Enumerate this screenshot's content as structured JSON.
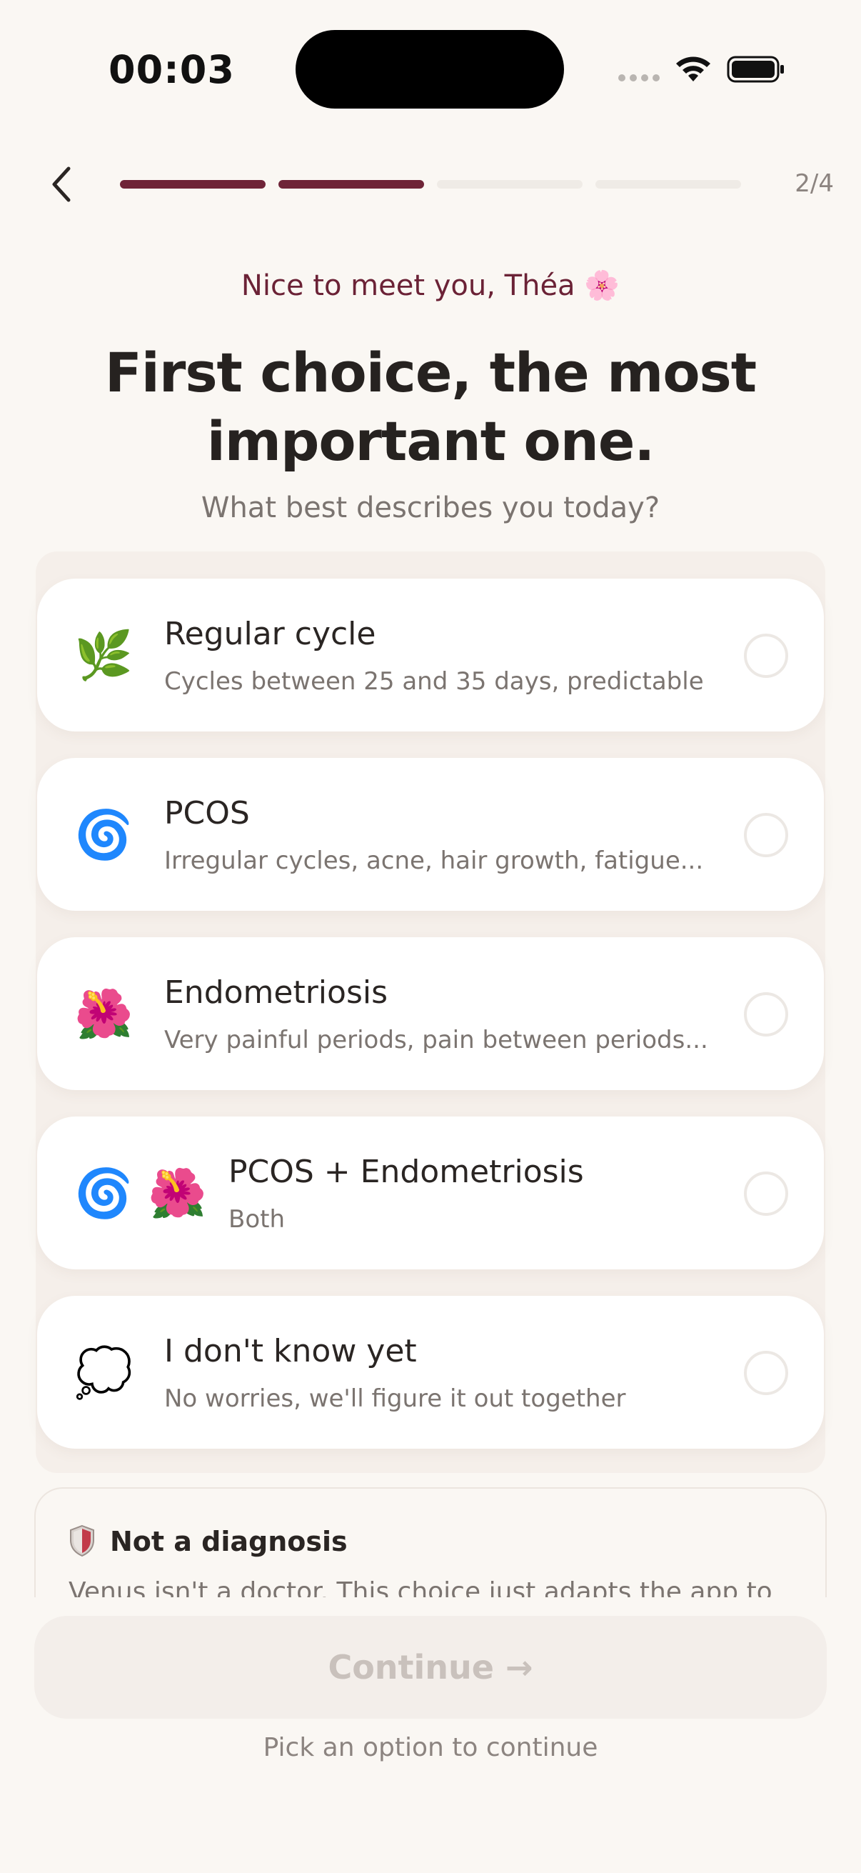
{
  "status_bar": {
    "time": "00:03"
  },
  "nav": {
    "step_count": "2/4",
    "progress": {
      "total": 4,
      "completed": 2
    }
  },
  "header": {
    "greeting": "Nice to meet you, Théa 🌸",
    "title_line1": "First choice, the most",
    "title_line2": "important one.",
    "subtitle": "What best describes you today?"
  },
  "options": [
    {
      "emoji": "🌿",
      "label": "Regular cycle",
      "desc": "Cycles between 25 and 35 days, predictable"
    },
    {
      "emoji": "🌀",
      "label": "PCOS",
      "desc": "Irregular cycles, acne, hair growth, fatigue..."
    },
    {
      "emoji": "🌺",
      "label": "Endometriosis",
      "desc": "Very painful periods, pain between periods..."
    },
    {
      "emoji": "🌀 🌺",
      "label": "PCOS + Endometriosis",
      "desc": "Both"
    },
    {
      "emoji": "💭",
      "label": "I don't know yet",
      "desc": "No worries, we'll figure it out together"
    }
  ],
  "notice": {
    "title": "Not a diagnosis",
    "body": "Venus isn't a doctor. This choice just adapts the app to"
  },
  "footer": {
    "continue_label": "Continue →",
    "hint": "Pick an option to continue"
  },
  "colors": {
    "accent": "#6f2438",
    "background": "#faf7f3",
    "card": "#ffffff"
  }
}
